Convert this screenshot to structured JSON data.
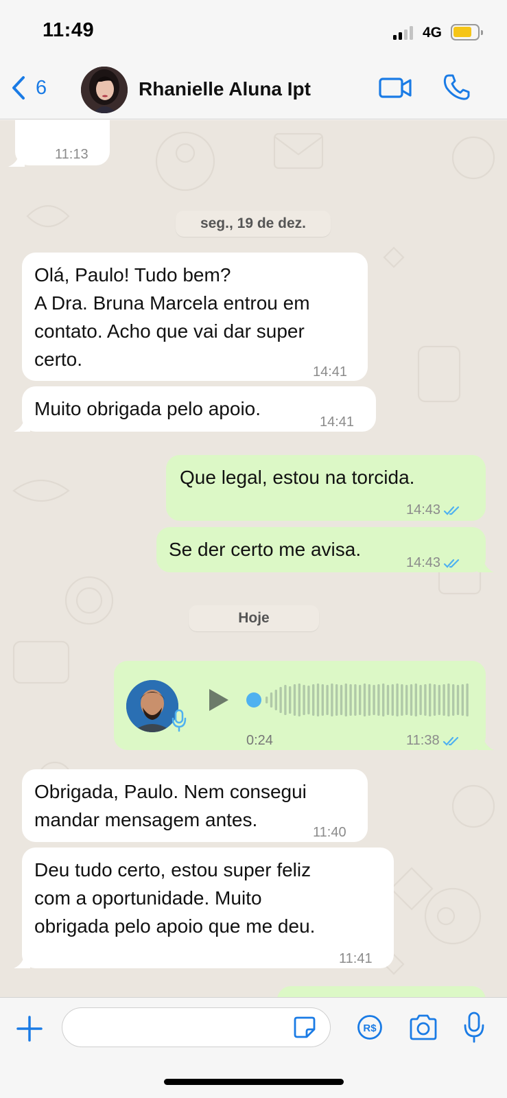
{
  "status": {
    "time": "11:49",
    "network": "4G"
  },
  "header": {
    "back_count": "6",
    "contact_name": "Rhanielle Aluna Ipt"
  },
  "messages": [
    {
      "type": "in",
      "text": "",
      "time": "11:13"
    },
    {
      "type": "date",
      "label": "seg., 19 de dez."
    },
    {
      "type": "in",
      "text": "Olá, Paulo! Tudo bem?\nA Dra. Bruna Marcela entrou em\ncontato. Acho que vai dar super\ncerto.",
      "time": "14:41"
    },
    {
      "type": "in",
      "text": "Muito obrigada pelo apoio.",
      "time": "14:41"
    },
    {
      "type": "out",
      "text": "Que legal, estou na torcida.",
      "time": "14:43"
    },
    {
      "type": "out",
      "text": "Se der certo me avisa.",
      "time": "14:43"
    },
    {
      "type": "date",
      "label": "Hoje"
    },
    {
      "type": "voice",
      "duration": "0:24",
      "time": "11:38",
      "progress": 0
    },
    {
      "type": "in",
      "text": "Obrigada, Paulo. Nem consegui\nmandar mensagem antes.",
      "time": "11:40"
    },
    {
      "type": "in",
      "text": "Deu tudo certo, estou super feliz\ncom a oportunidade. Muito\nobrigada pelo apoio que me deu.",
      "time": "11:41"
    }
  ],
  "input": {
    "placeholder": ""
  },
  "colors": {
    "accent": "#1a7be5",
    "outgoing_bubble": "#dcf8c6",
    "incoming_bubble": "#ffffff",
    "read_ticks": "#4fb1f0",
    "chat_background": "#ebe6df"
  },
  "icons": [
    "back-chevron",
    "video-call",
    "voice-call",
    "plus",
    "sticker",
    "payment-rs",
    "camera",
    "microphone",
    "play",
    "double-check"
  ]
}
